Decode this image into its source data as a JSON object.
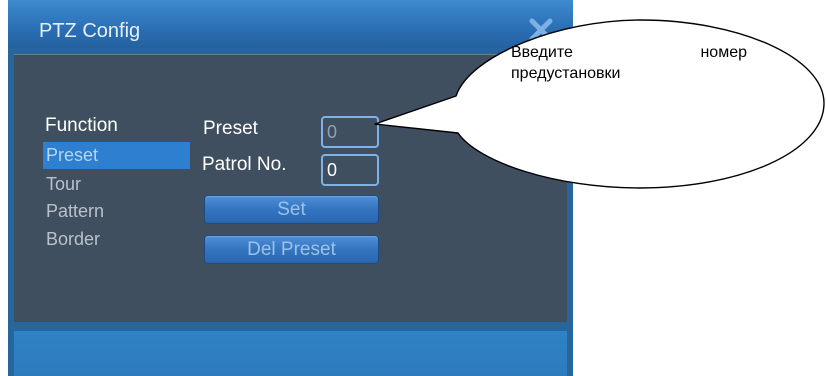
{
  "window": {
    "title": "PTZ Config",
    "close_icon": "close-x-icon"
  },
  "functions": {
    "heading": "Function",
    "items": [
      {
        "label": "Preset",
        "selected": true
      },
      {
        "label": "Tour",
        "selected": false
      },
      {
        "label": "Pattern",
        "selected": false
      },
      {
        "label": "Border",
        "selected": false
      }
    ]
  },
  "form": {
    "preset_label": "Preset",
    "preset_value": "0",
    "patrol_label": "Patrol No.",
    "patrol_value": "0",
    "set_button": "Set",
    "del_preset_button": "Del Preset"
  },
  "callout": {
    "word1": "Введите",
    "word2": "номер",
    "line2": "предустановки"
  },
  "colors": {
    "title_bar": "#2a6fb4",
    "panel": "#3f4f5f",
    "selected_item": "#2f7fd0",
    "button": "#3475c1",
    "field_border": "#7eb2e8"
  }
}
